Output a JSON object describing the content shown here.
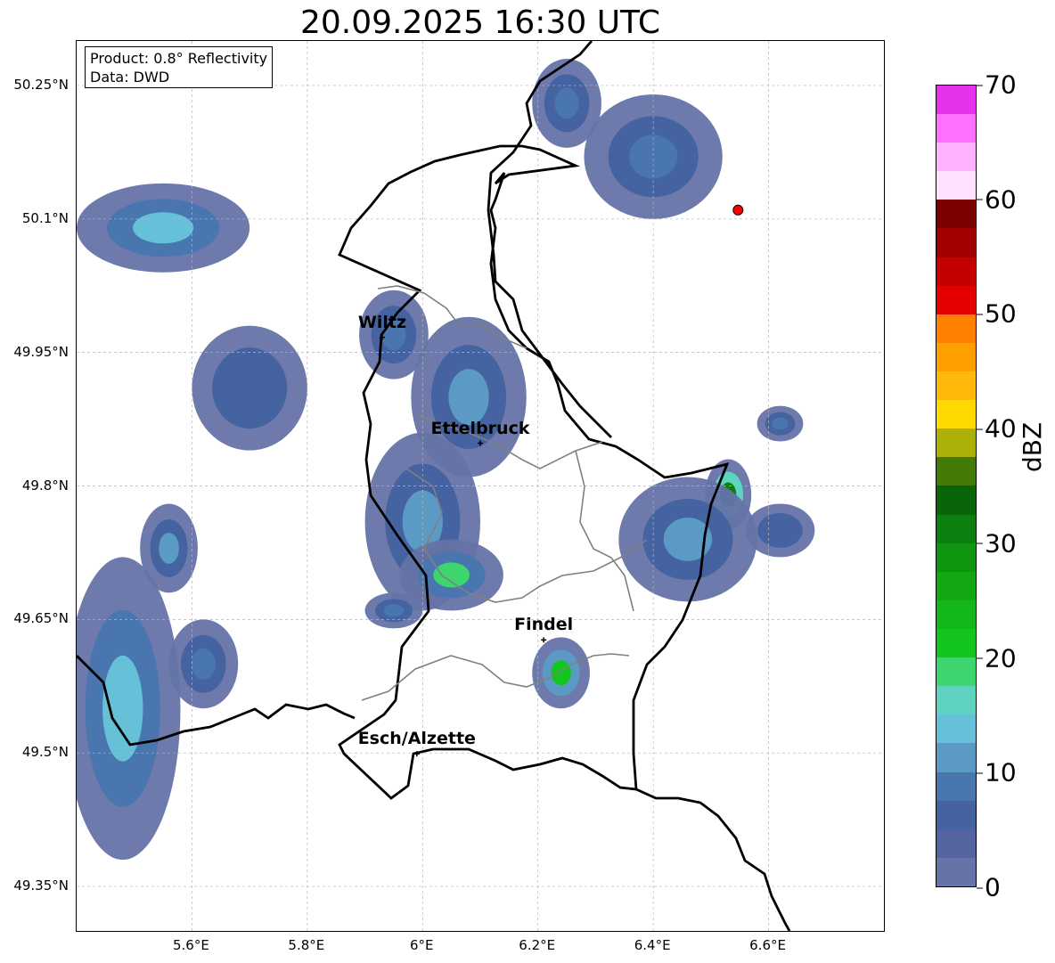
{
  "title": "20.09.2025 16:30 UTC",
  "info": {
    "product": "Product: 0.8° Reflectivity",
    "source": "Data: DWD"
  },
  "map": {
    "extent": {
      "lon": [
        5.4,
        6.8
      ],
      "lat": [
        49.3,
        50.3
      ]
    },
    "gridlines": true,
    "lat_ticks": [
      {
        "value": 50.25,
        "label": "50.25°N"
      },
      {
        "value": 50.1,
        "label": "50.1°N"
      },
      {
        "value": 49.95,
        "label": "49.95°N"
      },
      {
        "value": 49.8,
        "label": "49.8°N"
      },
      {
        "value": 49.65,
        "label": "49.65°N"
      },
      {
        "value": 49.5,
        "label": "49.5°N"
      },
      {
        "value": 49.35,
        "label": "49.35°N"
      }
    ],
    "lon_ticks": [
      {
        "value": 5.6,
        "label": "5.6°E"
      },
      {
        "value": 5.8,
        "label": "5.8°E"
      },
      {
        "value": 6.0,
        "label": "6°E"
      },
      {
        "value": 6.2,
        "label": "6.2°E"
      },
      {
        "value": 6.4,
        "label": "6.4°E"
      },
      {
        "value": 6.6,
        "label": "6.6°E"
      }
    ],
    "cities": [
      {
        "name": "Wiltz",
        "lon": 5.93,
        "lat": 49.967
      },
      {
        "name": "Ettelbruck",
        "lon": 6.1,
        "lat": 49.848
      },
      {
        "name": "Findel",
        "lon": 6.21,
        "lat": 49.627
      },
      {
        "name": "Esch/Alzette",
        "lon": 5.99,
        "lat": 49.499
      }
    ],
    "radar_site": {
      "lon": 6.547,
      "lat": 50.11,
      "color": "#ff0000"
    },
    "echo_cells": [
      {
        "lon": 5.95,
        "lat": 49.97,
        "rlon": 0.06,
        "rlat": 0.05,
        "dbz": 8
      },
      {
        "lon": 6.08,
        "lat": 49.9,
        "rlon": 0.1,
        "rlat": 0.09,
        "dbz": 10
      },
      {
        "lon": 6.0,
        "lat": 49.76,
        "rlon": 0.1,
        "rlat": 0.1,
        "dbz": 12
      },
      {
        "lon": 6.05,
        "lat": 49.7,
        "rlon": 0.09,
        "rlat": 0.04,
        "dbz": 18
      },
      {
        "lon": 6.24,
        "lat": 49.59,
        "rlon": 0.05,
        "rlat": 0.04,
        "dbz": 22
      },
      {
        "lon": 6.53,
        "lat": 49.79,
        "rlon": 0.04,
        "rlat": 0.04,
        "dbz": 30
      },
      {
        "lon": 6.46,
        "lat": 49.74,
        "rlon": 0.12,
        "rlat": 0.07,
        "dbz": 12
      },
      {
        "lon": 6.62,
        "lat": 49.75,
        "rlon": 0.06,
        "rlat": 0.03,
        "dbz": 6
      },
      {
        "lon": 6.62,
        "lat": 49.87,
        "rlon": 0.04,
        "rlat": 0.02,
        "dbz": 8
      },
      {
        "lon": 5.7,
        "lat": 49.91,
        "rlon": 0.1,
        "rlat": 0.07,
        "dbz": 7
      },
      {
        "lon": 5.55,
        "lat": 50.09,
        "rlon": 0.15,
        "rlat": 0.05,
        "dbz": 14
      },
      {
        "lon": 5.56,
        "lat": 49.73,
        "rlon": 0.05,
        "rlat": 0.05,
        "dbz": 12
      },
      {
        "lon": 5.48,
        "lat": 49.55,
        "rlon": 0.1,
        "rlat": 0.17,
        "dbz": 14
      },
      {
        "lon": 5.62,
        "lat": 49.6,
        "rlon": 0.06,
        "rlat": 0.05,
        "dbz": 9
      },
      {
        "lon": 6.4,
        "lat": 50.17,
        "rlon": 0.12,
        "rlat": 0.07,
        "dbz": 8
      },
      {
        "lon": 6.25,
        "lat": 50.23,
        "rlon": 0.06,
        "rlat": 0.05,
        "dbz": 8
      },
      {
        "lon": 5.95,
        "lat": 49.66,
        "rlon": 0.05,
        "rlat": 0.02,
        "dbz": 9
      }
    ]
  },
  "colorbar": {
    "label": "dBZ",
    "vmin": 0,
    "vmax": 70,
    "ticks": [
      {
        "value": 0,
        "label": "0"
      },
      {
        "value": 10,
        "label": "10"
      },
      {
        "value": 20,
        "label": "20"
      },
      {
        "value": 30,
        "label": "30"
      },
      {
        "value": 40,
        "label": "40"
      },
      {
        "value": 50,
        "label": "50"
      },
      {
        "value": 60,
        "label": "60"
      },
      {
        "value": 70,
        "label": "70"
      }
    ],
    "colors": [
      "#6573a6",
      "#54649e",
      "#4562a1",
      "#4a76b0",
      "#5a9ac4",
      "#66c1d8",
      "#5ed4c0",
      "#3dd66e",
      "#13c61e",
      "#12b718",
      "#12a713",
      "#0f9610",
      "#0c7f0f",
      "#0a650a",
      "#447a08",
      "#acb10a",
      "#ffd900",
      "#ffb90a",
      "#ffa000",
      "#ff8000",
      "#e50000",
      "#c40000",
      "#a00000",
      "#7a0000",
      "#ffe0ff",
      "#ffb2ff",
      "#ff70ff",
      "#e632ea"
    ]
  }
}
